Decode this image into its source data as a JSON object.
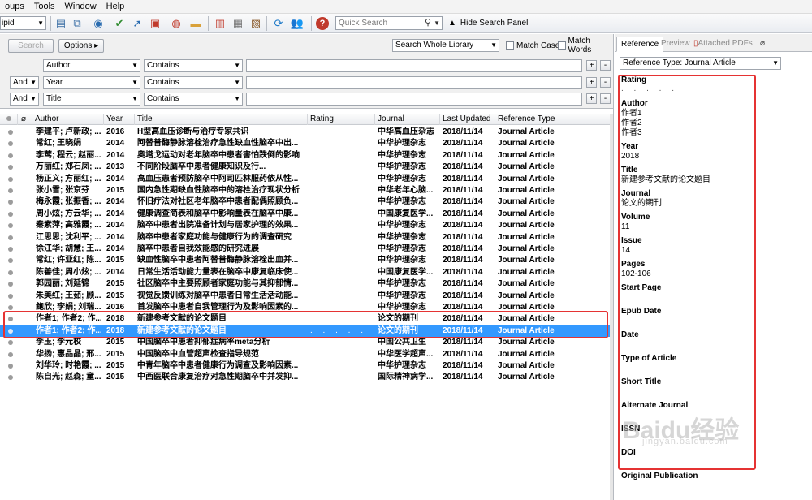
{
  "menu": [
    "oups",
    "Tools",
    "Window",
    "Help"
  ],
  "toolbar": {
    "group_select": "ipid",
    "quick_search_placeholder": "Quick Search",
    "hide_panel": "Hide Search Panel",
    "icons": [
      "new-reference-icon",
      "copy-icon",
      "online-search-icon",
      "find-fulltext-icon",
      "import-icon",
      "export-icon",
      "open-link-icon",
      "open-file-icon",
      "insert-citation-icon",
      "format-bibliography-icon",
      "bookmark-icon",
      "sync-icon",
      "share-icon",
      "help-icon"
    ]
  },
  "search": {
    "search_button": "Search",
    "options_button": "Options",
    "scope": "Search Whole Library",
    "match_case": "Match Case",
    "match_words": "Match Words",
    "rows": [
      {
        "bool": "",
        "field": "Author",
        "op": "Contains",
        "value": ""
      },
      {
        "bool": "And",
        "field": "Year",
        "op": "Contains",
        "value": ""
      },
      {
        "bool": "And",
        "field": "Title",
        "op": "Contains",
        "value": ""
      }
    ]
  },
  "table": {
    "columns": [
      "Author",
      "Year",
      "Title",
      "Rating",
      "Journal",
      "Last Updated",
      "Reference Type"
    ],
    "rows": [
      {
        "author": "李建平; 卢新政; ...",
        "year": "2016",
        "title": "H型高血压诊断与治疗专家共识",
        "rating": "",
        "journal": "中华高血压杂志",
        "updated": "2018/11/14",
        "type": "Journal Article"
      },
      {
        "author": "常红; 王晓娟",
        "year": "2014",
        "title": "阿替普酶静脉溶栓治疗急性缺血性脑卒中出...",
        "rating": "",
        "journal": "中华护理杂志",
        "updated": "2018/11/14",
        "type": "Journal Article"
      },
      {
        "author": "李莺; 程云; 赵丽...",
        "year": "2014",
        "title": "奥塔戈运动对老年脑卒中患者害怕跌倒的影响",
        "rating": "",
        "journal": "中华护理杂志",
        "updated": "2018/11/14",
        "type": "Journal Article"
      },
      {
        "author": "万丽红; 郑石凤; ...",
        "year": "2013",
        "title": "不同阶段脑卒中患者健康知识及行...",
        "rating": "",
        "journal": "中华护理杂志",
        "updated": "2018/11/14",
        "type": "Journal Article"
      },
      {
        "author": "杨正义; 方丽红; ...",
        "year": "2014",
        "title": "高血压患者预防脑卒中阿司匹林服药依从性...",
        "rating": "",
        "journal": "中华护理杂志",
        "updated": "2018/11/14",
        "type": "Journal Article"
      },
      {
        "author": "张小雪; 张京芬",
        "year": "2015",
        "title": "国内急性期缺血性脑卒中的溶栓治疗现状分析",
        "rating": "",
        "journal": "中华老年心脑...",
        "updated": "2018/11/14",
        "type": "Journal Article"
      },
      {
        "author": "梅永霞; 张振香; ...",
        "year": "2014",
        "title": "怀旧疗法对社区老年脑卒中患者配偶照顾负...",
        "rating": "",
        "journal": "中华护理杂志",
        "updated": "2018/11/14",
        "type": "Journal Article"
      },
      {
        "author": "周小炫; 方云华; ...",
        "year": "2014",
        "title": "健康调查简表和脑卒中影响量表在脑卒中康...",
        "rating": "",
        "journal": "中国康复医学...",
        "updated": "2018/11/14",
        "type": "Journal Article"
      },
      {
        "author": "秦素萍; 高雅霞; ...",
        "year": "2014",
        "title": "脑卒中患者出院准备计划与居家护理的效果...",
        "rating": "",
        "journal": "中华护理杂志",
        "updated": "2018/11/14",
        "type": "Journal Article"
      },
      {
        "author": "江思思; 沈利平; ...",
        "year": "2014",
        "title": "脑卒中患者家庭功能与健康行为的调查研究",
        "rating": "",
        "journal": "中华护理杂志",
        "updated": "2018/11/14",
        "type": "Journal Article"
      },
      {
        "author": "徐江华; 胡慧; 王...",
        "year": "2014",
        "title": "脑卒中患者自我效能感的研究进展",
        "rating": "",
        "journal": "中华护理杂志",
        "updated": "2018/11/14",
        "type": "Journal Article"
      },
      {
        "author": "常红; 许亚红; 陈...",
        "year": "2015",
        "title": "缺血性脑卒中患者阿替普酶静脉溶栓出血并...",
        "rating": "",
        "journal": "中华护理杂志",
        "updated": "2018/11/14",
        "type": "Journal Article"
      },
      {
        "author": "陈善佳; 周小炫; ...",
        "year": "2014",
        "title": "日常生活活动能力量表在脑卒中康复临床使...",
        "rating": "",
        "journal": "中国康复医学...",
        "updated": "2018/11/14",
        "type": "Journal Article"
      },
      {
        "author": "郭园丽; 刘延锦",
        "year": "2015",
        "title": "社区脑卒中主要照顾者家庭功能与其抑郁情...",
        "rating": "",
        "journal": "中华护理杂志",
        "updated": "2018/11/14",
        "type": "Journal Article"
      },
      {
        "author": "朱美红; 王茹; 顾...",
        "year": "2015",
        "title": "视觉反馈训练对脑卒中患者日常生活活动能...",
        "rating": "",
        "journal": "中华护理杂志",
        "updated": "2018/11/14",
        "type": "Journal Article"
      },
      {
        "author": "鲍欣; 李娟; 刘瑞...",
        "year": "2016",
        "title": "首发脑卒中患者自我管理行为及影响因素的...",
        "rating": "",
        "journal": "中华护理杂志",
        "updated": "2018/11/14",
        "type": "Journal Article"
      },
      {
        "author": "作者1; 作者2; 作...",
        "year": "2018",
        "title": "新建参考文献的论文题目",
        "rating": "",
        "journal": "论文的期刊",
        "updated": "2018/11/14",
        "type": "Journal Article"
      },
      {
        "author": "作者1; 作者2; 作...",
        "year": "2018",
        "title": "新建参考文献的论文题目",
        "rating": ". . . . .",
        "journal": "论文的期刊",
        "updated": "2018/11/14",
        "type": "Journal Article"
      },
      {
        "author": "李玉; 李元校",
        "year": "2015",
        "title": "中国脑卒中患者抑郁症病率meta分析",
        "rating": "",
        "journal": "中国公共卫生",
        "updated": "2018/11/14",
        "type": "Journal Article"
      },
      {
        "author": "华扬; 惠品晶; 邢...",
        "year": "2015",
        "title": "中国脑卒中血管超声检查指导规范",
        "rating": "",
        "journal": "中华医学超声...",
        "updated": "2018/11/14",
        "type": "Journal Article"
      },
      {
        "author": "刘华玲; 时艳霞; ...",
        "year": "2015",
        "title": "中青年脑卒中患者健康行为调查及影响因素...",
        "rating": "",
        "journal": "中华护理杂志",
        "updated": "2018/11/14",
        "type": "Journal Article"
      },
      {
        "author": "陈自光; 赵森; 童...",
        "year": "2015",
        "title": "中西医联合康复治疗对急性期脑卒中并发抑...",
        "rating": "",
        "journal": "国际精神病学...",
        "updated": "2018/11/14",
        "type": "Journal Article"
      }
    ]
  },
  "panel": {
    "tabs": [
      "Reference",
      "Preview",
      "Attached PDFs"
    ],
    "ref_type": "Reference Type:  Journal Article",
    "fields": [
      {
        "label": "Rating",
        "values": [],
        "rating": ". . . . ."
      },
      {
        "label": "Author",
        "values": [
          "作者1",
          "作者2",
          "作者3"
        ]
      },
      {
        "label": "Year",
        "values": [
          "2018"
        ]
      },
      {
        "label": "Title",
        "values": [
          "新建参考文献的论文题目"
        ]
      },
      {
        "label": "Journal",
        "values": [
          "论文的期刊"
        ]
      },
      {
        "label": "Volume",
        "values": [
          "11"
        ]
      },
      {
        "label": "Issue",
        "values": [
          "14"
        ]
      },
      {
        "label": "Pages",
        "values": [
          "102-106"
        ]
      },
      {
        "label": "Start Page",
        "values": []
      },
      {
        "label": "Epub Date",
        "values": []
      },
      {
        "label": "Date",
        "values": []
      },
      {
        "label": "Type of Article",
        "values": []
      },
      {
        "label": "Short Title",
        "values": []
      },
      {
        "label": "Alternate Journal",
        "values": []
      },
      {
        "label": "ISSN",
        "values": []
      },
      {
        "label": "DOI",
        "values": []
      },
      {
        "label": "Original Publication",
        "values": []
      }
    ]
  },
  "watermark": "Baidu经验",
  "watermark_sub": "jingyan.baidu.com",
  "colors": {
    "selection": "#3399ff",
    "highlight_box": "#e53333"
  }
}
